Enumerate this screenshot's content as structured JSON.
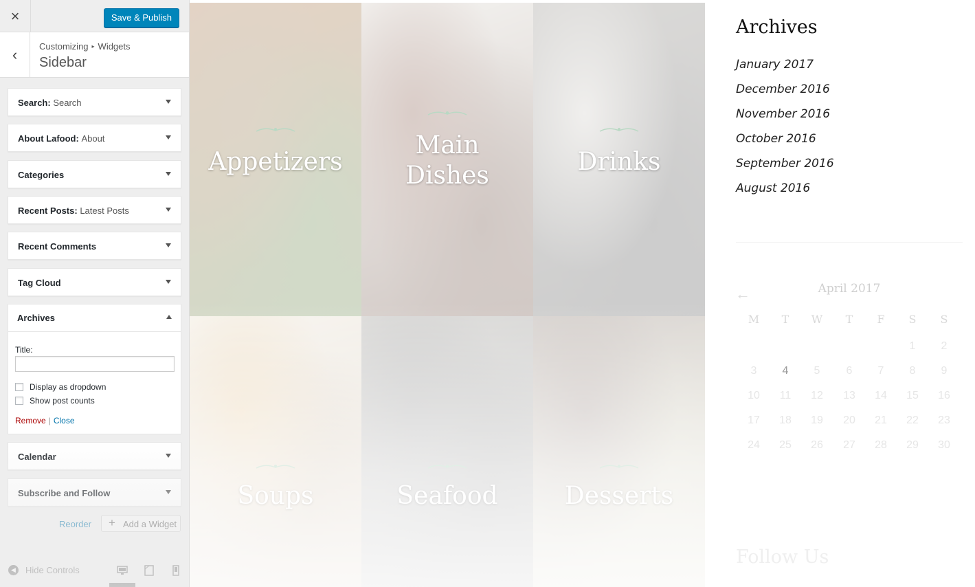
{
  "customizer": {
    "close_icon": "×",
    "publish_label": "Save & Publish",
    "back_icon": "‹",
    "breadcrumb": [
      "Customizing",
      "Widgets"
    ],
    "breadcrumb_sep": "▸",
    "section_title": "Sidebar",
    "widgets": [
      {
        "name": "Search",
        "subtitle": "Search"
      },
      {
        "name": "About Lafood",
        "subtitle": "About"
      },
      {
        "name": "Categories",
        "subtitle": ""
      },
      {
        "name": "Recent Posts",
        "subtitle": "Latest Posts"
      },
      {
        "name": "Recent Comments",
        "subtitle": ""
      },
      {
        "name": "Tag Cloud",
        "subtitle": ""
      },
      {
        "name": "Archives",
        "subtitle": ""
      },
      {
        "name": "Calendar",
        "subtitle": ""
      },
      {
        "name": "Subscribe and Follow",
        "subtitle": ""
      }
    ],
    "open_widget": {
      "title_label": "Title:",
      "title_value": "",
      "options": [
        "Display as dropdown",
        "Show post counts"
      ],
      "remove": "Remove",
      "separator": "|",
      "close": "Close"
    },
    "reorder": "Reorder",
    "add_widget_icon": "+",
    "add_widget": "Add a Widget",
    "hide_controls": "Hide Controls",
    "colors": {
      "primary": "#0085ba",
      "link": "#0073aa",
      "remove": "#aa0000"
    }
  },
  "preview": {
    "tiles": [
      {
        "label": "Appetizers",
        "colors": [
          "#8a6a3a",
          "#5b7a3a",
          "#a0602f"
        ]
      },
      {
        "label": "Main\nDishes",
        "colors": [
          "#7a4b3a",
          "#5a3a2c",
          "#d9d5cc"
        ]
      },
      {
        "label": "Drinks",
        "colors": [
          "#c9c5bf",
          "#4a4a4a",
          "#7e7a73"
        ]
      },
      {
        "label": "Soups",
        "colors": [
          "#d2a35a",
          "#9b7b52",
          "#e7dfcf"
        ]
      },
      {
        "label": "Seafood",
        "colors": [
          "#4c4b4a",
          "#2e2e2e",
          "#8a8780"
        ]
      },
      {
        "label": "Desserts",
        "colors": [
          "#5a4238",
          "#a9a47c",
          "#7a6a5f"
        ]
      }
    ],
    "archives_title": "Archives",
    "archives": [
      "January 2017",
      "December 2016",
      "November 2016",
      "October 2016",
      "September 2016",
      "August 2016"
    ],
    "calendar": {
      "prev_icon": "←",
      "title": "April 2017",
      "weekdays": [
        "M",
        "T",
        "W",
        "T",
        "F",
        "S",
        "S"
      ],
      "weeks": [
        [
          "",
          "",
          "",
          "",
          "",
          "1",
          "2"
        ],
        [
          "3",
          "4",
          "5",
          "6",
          "7",
          "8",
          "9"
        ],
        [
          "10",
          "11",
          "12",
          "13",
          "14",
          "15",
          "16"
        ],
        [
          "17",
          "18",
          "19",
          "20",
          "21",
          "22",
          "23"
        ],
        [
          "24",
          "25",
          "26",
          "27",
          "28",
          "29",
          "30"
        ]
      ],
      "days_with_posts": [
        "4"
      ]
    },
    "follow_title": "Follow Us"
  }
}
